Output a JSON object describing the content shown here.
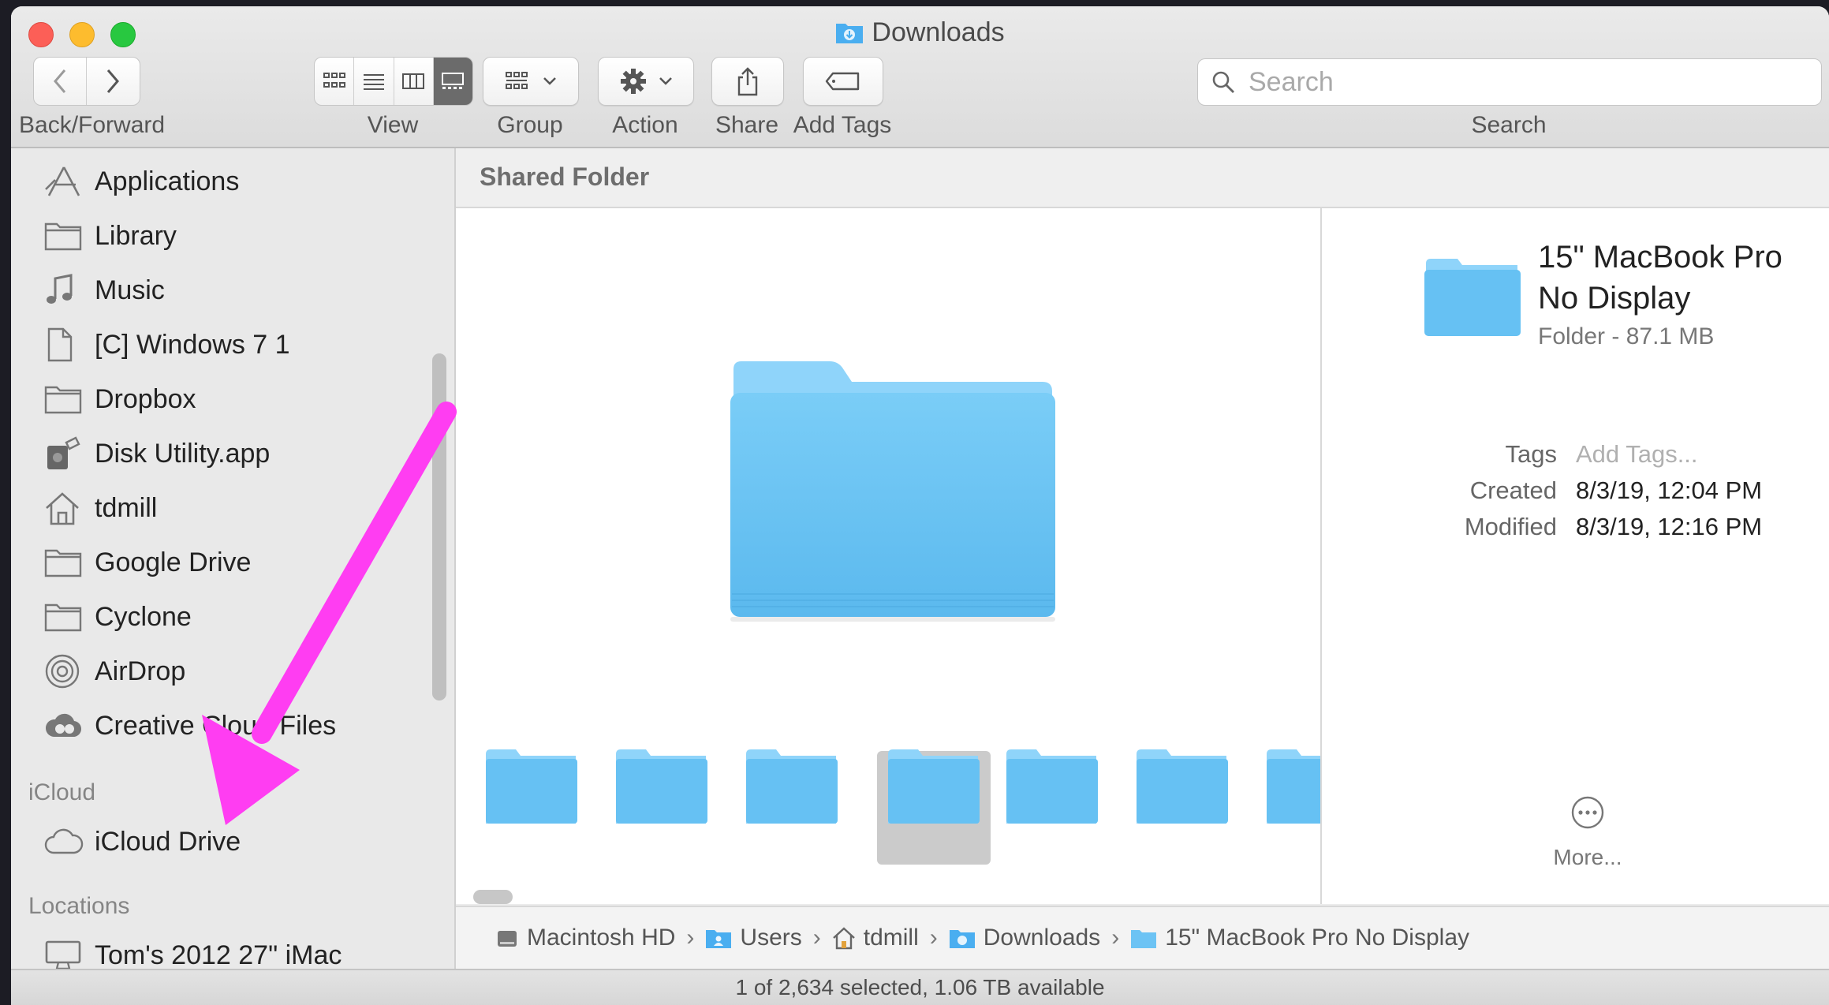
{
  "window": {
    "title": "Downloads",
    "title_icon": "downloads-folder-icon"
  },
  "toolbar": {
    "back_forward_label": "Back/Forward",
    "view_label": "View",
    "group_label": "Group",
    "action_label": "Action",
    "share_label": "Share",
    "add_tags_label": "Add Tags",
    "search_label": "Search",
    "search_placeholder": "Search",
    "active_view": "gallery"
  },
  "sidebar": {
    "items": [
      {
        "label": "Applications",
        "icon": "applications-icon"
      },
      {
        "label": "Library",
        "icon": "folder-icon"
      },
      {
        "label": "Music",
        "icon": "music-note-icon"
      },
      {
        "label": "[C] Windows 7 1",
        "icon": "document-icon"
      },
      {
        "label": "Dropbox",
        "icon": "folder-icon"
      },
      {
        "label": "Disk Utility.app",
        "icon": "disk-utility-icon"
      },
      {
        "label": "tdmill",
        "icon": "home-icon"
      },
      {
        "label": "Google Drive",
        "icon": "folder-icon"
      },
      {
        "label": "Cyclone",
        "icon": "folder-icon"
      },
      {
        "label": "AirDrop",
        "icon": "airdrop-icon"
      },
      {
        "label": "Creative Cloud Files",
        "icon": "creative-cloud-icon"
      }
    ],
    "icloud_heading": "iCloud",
    "icloud_items": [
      {
        "label": "iCloud Drive",
        "icon": "cloud-icon"
      }
    ],
    "locations_heading": "Locations",
    "location_items": [
      {
        "label": "Tom's 2012 27\" iMac",
        "icon": "imac-icon"
      }
    ]
  },
  "gallery": {
    "header": "Shared Folder",
    "thumbnail_count": 7,
    "selected_index": 3
  },
  "preview": {
    "name": "15\" MacBook Pro No Display",
    "kind_size": "Folder - 87.1 MB",
    "tags_label": "Tags",
    "tags_placeholder": "Add Tags...",
    "created_label": "Created",
    "created_value": "8/3/19, 12:04 PM",
    "modified_label": "Modified",
    "modified_value": "8/3/19, 12:16 PM",
    "more_label": "More..."
  },
  "pathbar": {
    "crumbs": [
      {
        "label": "Macintosh HD",
        "icon": "hard-drive-icon"
      },
      {
        "label": "Users",
        "icon": "users-folder-icon"
      },
      {
        "label": "tdmill",
        "icon": "home-icon"
      },
      {
        "label": "Downloads",
        "icon": "downloads-folder-icon"
      },
      {
        "label": "15\" MacBook Pro No Display",
        "icon": "folder-icon"
      }
    ]
  },
  "status": {
    "text": "1 of 2,634 selected, 1.06 TB available"
  },
  "annotation": {
    "arrow_color": "#ff3df2",
    "target": "iCloud Drive"
  },
  "colors": {
    "folder_blue": "#6cc3f4",
    "folder_blue_light": "#8fd4fa"
  }
}
